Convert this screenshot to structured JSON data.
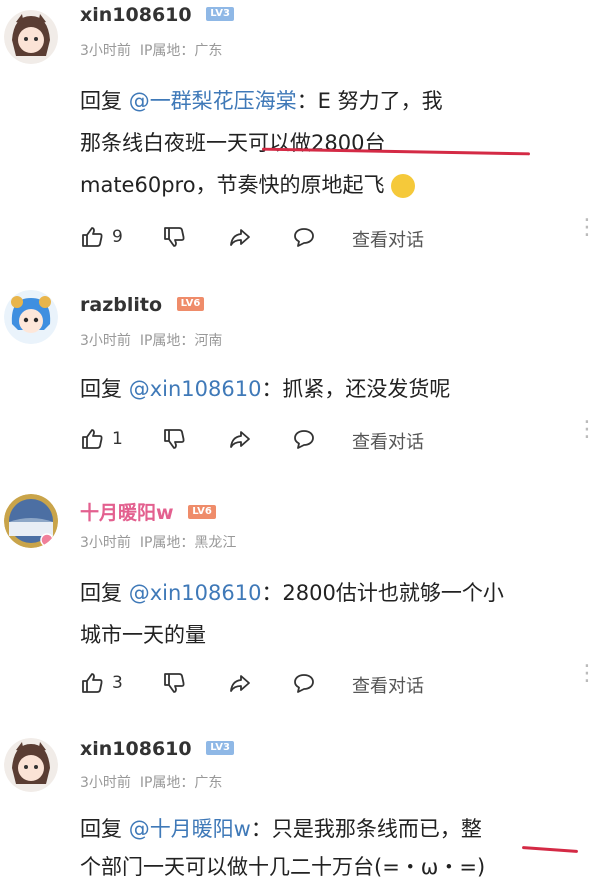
{
  "comments": [
    {
      "username": "xin108610",
      "level": "LV3",
      "time": "3小时前",
      "ip": "IP属地：广东",
      "reply_prefix": "回复",
      "mention": "@一群梨花压海棠",
      "text_line1": "：E      努力了，我",
      "text_line2": "那条线白夜班一天可以做2800台",
      "text_line3": "mate60pro，节奏快的原地起飞",
      "likes": "9",
      "view_dialog": "查看对话"
    },
    {
      "username": "razblito",
      "level": "LV6",
      "time": "3小时前",
      "ip": "IP属地：河南",
      "reply_prefix": "回复",
      "mention": "@xin108610",
      "text_line1": "：抓紧，还没发货呢",
      "likes": "1",
      "view_dialog": "查看对话"
    },
    {
      "username": "十月暖阳w",
      "level": "LV6",
      "time": "3小时前",
      "ip": "IP属地：黑龙江",
      "reply_prefix": "回复",
      "mention": "@xin108610",
      "text_line1": "：2800估计也就够一个小",
      "text_line2": "城市一天的量",
      "likes": "3",
      "view_dialog": "查看对话"
    },
    {
      "username": "xin108610",
      "level": "LV3",
      "time": "3小时前",
      "ip": "IP属地：广东",
      "reply_prefix": "回复",
      "mention": "@十月暖阳w",
      "text_line1": "：只是我那条线而已，整",
      "text_line2": "个部门一天可以做十几二十万台(=・ω・=)"
    }
  ],
  "colors": {
    "lv3": "#8fb8e6",
    "lv6": "#ef8c6a",
    "mention": "#3f79b8",
    "underline": "#d42a45"
  },
  "icons": [
    "thumb-up-icon",
    "thumb-down-icon",
    "share-icon",
    "comment-bubble-icon",
    "more-vertical-icon"
  ]
}
